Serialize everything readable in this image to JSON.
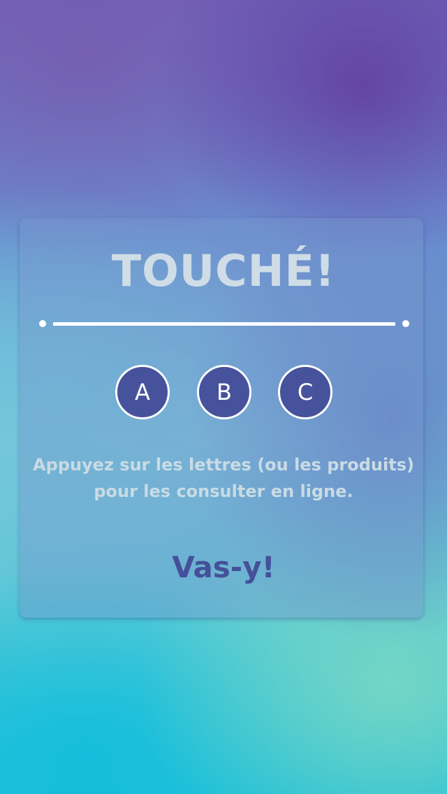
{
  "dialog": {
    "title": "TOUCHÉ!",
    "letters": [
      "A",
      "B",
      "C"
    ],
    "instruction_line1": "Appuyez sur les lettres (ou les produits)",
    "instruction_line2": "pour les consulter en ligne.",
    "go_label": "Vas-y!"
  },
  "colors": {
    "letter_circle": "#47529c",
    "go_text": "#45509a",
    "title_text": "#cfdde6",
    "body_text": "#c9dbe4"
  }
}
